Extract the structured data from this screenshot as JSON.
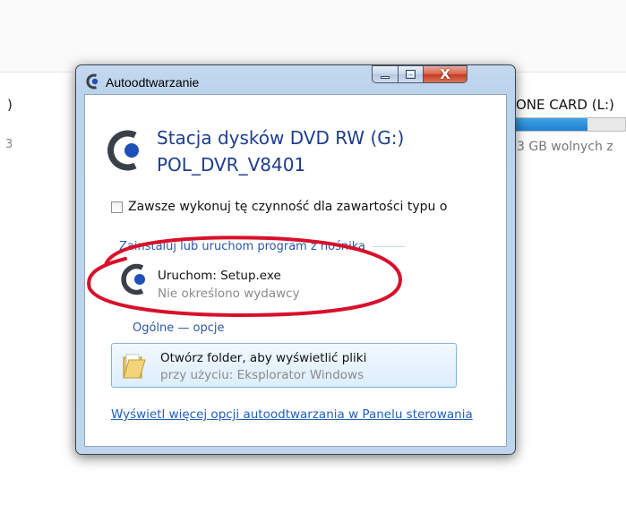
{
  "background": {
    "left_paren": ")",
    "left_size_fragment": "3",
    "drive_name_fragment": "ONE CARD (L:)",
    "drive_usage_fraction": 0.66,
    "free_space_fragment": "3 GB wolnych z"
  },
  "window": {
    "title": "Autoodtwarzanie",
    "close_glyph": "X"
  },
  "drive": {
    "name": "Stacja dysków DVD RW (G:)",
    "label": "POL_DVR_V8401"
  },
  "always_checkbox": {
    "label": "Zawsze wykonuj tę czynność dla zawartości typu o",
    "checked": false
  },
  "install_section": {
    "title": "Zainstaluj lub uruchom program z nośnika",
    "items": [
      {
        "title": "Uruchom: Setup.exe",
        "subtitle": "Nie określono wydawcy",
        "icon": "autoplay-disc-icon"
      }
    ]
  },
  "general_section": {
    "title": "Ogólne — opcje",
    "items": [
      {
        "title": "Otwórz folder, aby wyświetlić pliki",
        "subtitle": "przy użyciu: Eksplorator Windows",
        "icon": "folder-icon"
      }
    ]
  },
  "more_options_link": "Wyświetl więcej opcji autoodtwarzania w Panelu sterowania",
  "colors": {
    "accent_text": "#1e3d8f",
    "link": "#1f5fbf",
    "annotation_red": "#d8102a"
  }
}
